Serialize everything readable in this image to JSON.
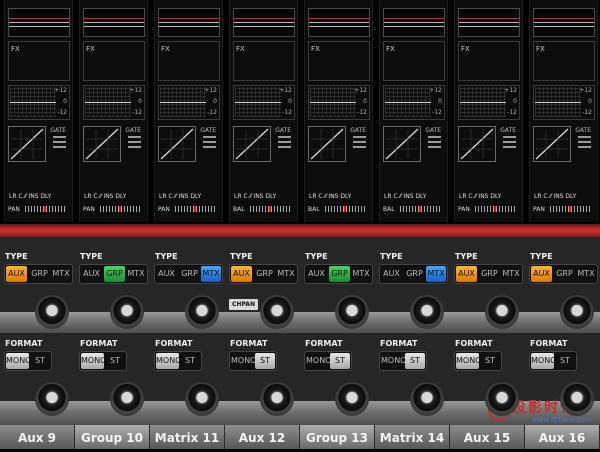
{
  "channels": [
    {
      "name": "Aux 9",
      "fx_label": "FX",
      "eq_ticks": [
        "+12",
        "0",
        "-12"
      ],
      "gate_label": "GATE",
      "routing": "LR  C  ⁄⁄ INS  DLY",
      "pan_label": "PAN",
      "type": {
        "label": "TYPE",
        "aux": "AUX",
        "grp": "GRP",
        "mtx": "MTX",
        "active": "aux"
      },
      "format": {
        "label": "FORMAT",
        "mono": "MONO",
        "st": "ST",
        "active": "mono"
      }
    },
    {
      "name": "Group 10",
      "fx_label": "FX",
      "eq_ticks": [
        "+12",
        "0",
        "-12"
      ],
      "gate_label": "GATE",
      "routing": "LR  C  ⁄⁄ INS  DLY",
      "pan_label": "PAN",
      "type": {
        "label": "TYPE",
        "aux": "AUX",
        "grp": "GRP",
        "mtx": "MTX",
        "active": "grp"
      },
      "format": {
        "label": "FORMAT",
        "mono": "MONO",
        "st": "ST",
        "active": "mono"
      }
    },
    {
      "name": "Matrix 11",
      "fx_label": "FX",
      "eq_ticks": [
        "+12",
        "0",
        "-12"
      ],
      "gate_label": "GATE",
      "routing": "LR  C  ⁄⁄ INS  DLY",
      "pan_label": "PAN",
      "type": {
        "label": "TYPE",
        "aux": "AUX",
        "grp": "GRP",
        "mtx": "MTX",
        "active": "mtx"
      },
      "format": {
        "label": "FORMAT",
        "mono": "MONO",
        "st": "ST",
        "active": "mono"
      }
    },
    {
      "name": "Aux 12",
      "fx_label": "FX",
      "eq_ticks": [
        "+12",
        "0",
        "-12"
      ],
      "gate_label": "GATE",
      "routing": "LR  C  ⁄⁄ INS  DLY",
      "pan_label": "BAL",
      "type": {
        "label": "TYPE",
        "aux": "AUX",
        "grp": "GRP",
        "mtx": "MTX",
        "active": "aux"
      },
      "format": {
        "label": "FORMAT",
        "mono": "MONO",
        "st": "ST",
        "active": "st"
      }
    },
    {
      "name": "Group 13",
      "fx_label": "FX",
      "eq_ticks": [
        "+12",
        "0",
        "-12"
      ],
      "gate_label": "GATE",
      "routing": "LR  C  ⁄⁄ INS  DLY",
      "pan_label": "BAL",
      "type": {
        "label": "TYPE",
        "aux": "AUX",
        "grp": "GRP",
        "mtx": "MTX",
        "active": "grp"
      },
      "format": {
        "label": "FORMAT",
        "mono": "MONO",
        "st": "ST",
        "active": "st"
      }
    },
    {
      "name": "Matrix 14",
      "fx_label": "FX",
      "eq_ticks": [
        "+12",
        "0",
        "-12"
      ],
      "gate_label": "GATE",
      "routing": "LR  C  ⁄⁄ INS  DLY",
      "pan_label": "BAL",
      "type": {
        "label": "TYPE",
        "aux": "AUX",
        "grp": "GRP",
        "mtx": "MTX",
        "active": "mtx"
      },
      "format": {
        "label": "FORMAT",
        "mono": "MONO",
        "st": "ST",
        "active": "st"
      }
    },
    {
      "name": "Aux 15",
      "fx_label": "FX",
      "eq_ticks": [
        "+12",
        "0",
        "-12"
      ],
      "gate_label": "GATE",
      "routing": "LR  C  ⁄⁄ INS  DLY",
      "pan_label": "PAN",
      "type": {
        "label": "TYPE",
        "aux": "AUX",
        "grp": "GRP",
        "mtx": "MTX",
        "active": "aux"
      },
      "format": {
        "label": "FORMAT",
        "mono": "MONO",
        "st": "ST",
        "active": "mono"
      }
    },
    {
      "name": "Aux 16",
      "fx_label": "FX",
      "eq_ticks": [
        "+12",
        "0",
        "-12"
      ],
      "gate_label": "GATE",
      "routing": "LR  C  ⁄⁄ INS  DLY",
      "pan_label": "PAN",
      "type": {
        "label": "TYPE",
        "aux": "AUX",
        "grp": "GRP",
        "mtx": "MTX",
        "active": "aux"
      },
      "format": {
        "label": "FORMAT",
        "mono": "MONO",
        "st": "ST",
        "active": "mono"
      }
    }
  ],
  "chpan_label": "CHPAN",
  "watermark": {
    "cn": "投影时代",
    "url": "www.PjTime.com"
  },
  "colors": {
    "aux_active": "#f39c1f",
    "grp_active": "#2fb54a",
    "mtx_active": "#2f7fe0",
    "separator": "#c82828",
    "meter_red": "#e02020"
  },
  "icons": {
    "knob": "rotary-knob-icon",
    "gate": "gate-curve-icon"
  }
}
